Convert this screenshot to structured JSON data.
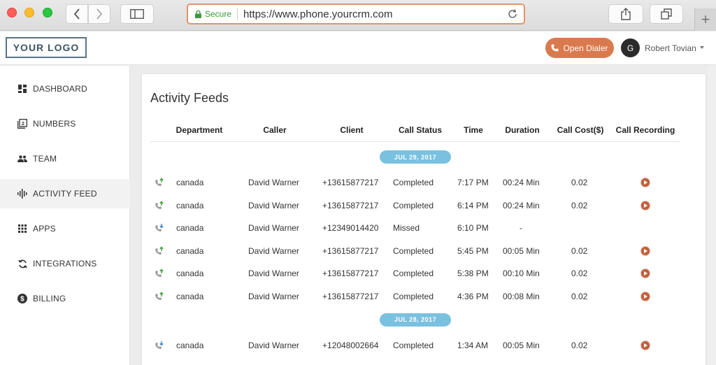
{
  "browser": {
    "secure_label": "Secure",
    "url": "https://www.phone.yourcrm.com",
    "new_tab_symbol": "+"
  },
  "header": {
    "logo_text": "YOUR LOGO",
    "dialer_label": "Open Dialer",
    "avatar_initial": "G",
    "user_name": "Robert Tovian"
  },
  "sidebar": {
    "items": [
      {
        "label": "DASHBOARD",
        "icon": "dashboard-icon"
      },
      {
        "label": "NUMBERS",
        "icon": "numbers-icon"
      },
      {
        "label": "TEAM",
        "icon": "team-icon"
      },
      {
        "label": "ACTIVITY FEED",
        "icon": "activity-icon"
      },
      {
        "label": "APPS",
        "icon": "apps-icon"
      },
      {
        "label": "INTEGRATIONS",
        "icon": "integrations-icon"
      },
      {
        "label": "BILLING",
        "icon": "billing-icon"
      }
    ],
    "active_index": 3
  },
  "main": {
    "title": "Activity Feeds",
    "columns": [
      "Department",
      "Caller",
      "Client",
      "Call Status",
      "Time",
      "Duration",
      "Call Cost($)",
      "Call Recording"
    ],
    "groups": [
      {
        "date": "JUL 29, 2017",
        "rows": [
          {
            "direction": "outgoing",
            "department": "canada",
            "caller": "David Warner",
            "client": "+13615877217",
            "status": "Completed",
            "time": "7:17 PM",
            "duration": "00:24 Min",
            "cost": "0.02",
            "recording": true
          },
          {
            "direction": "outgoing",
            "department": "canada",
            "caller": "David Warner",
            "client": "+13615877217",
            "status": "Completed",
            "time": "6:14 PM",
            "duration": "00:24 Min",
            "cost": "0.02",
            "recording": true
          },
          {
            "direction": "incoming",
            "department": "canada",
            "caller": "David Warner",
            "client": "+12349014420",
            "status": "Missed",
            "time": "6:10 PM",
            "duration": "-",
            "cost": "",
            "recording": false
          },
          {
            "direction": "outgoing",
            "department": "canada",
            "caller": "David Warner",
            "client": "+13615877217",
            "status": "Completed",
            "time": "5:45 PM",
            "duration": "00:05 Min",
            "cost": "0.02",
            "recording": true
          },
          {
            "direction": "outgoing",
            "department": "canada",
            "caller": "David Warner",
            "client": "+13615877217",
            "status": "Completed",
            "time": "5:38 PM",
            "duration": "00:10 Min",
            "cost": "0.02",
            "recording": true
          },
          {
            "direction": "outgoing",
            "department": "canada",
            "caller": "David Warner",
            "client": "+13615877217",
            "status": "Completed",
            "time": "4:36 PM",
            "duration": "00:08 Min",
            "cost": "0.02",
            "recording": true
          }
        ]
      },
      {
        "date": "JUL 28, 2017",
        "rows": [
          {
            "direction": "incoming",
            "department": "canada",
            "caller": "David Warner",
            "client": "+12048002664",
            "status": "Completed",
            "time": "1:34 AM",
            "duration": "00:05 Min",
            "cost": "0.02",
            "recording": true
          }
        ]
      }
    ]
  },
  "colors": {
    "accent": "#d97a4e",
    "date_pill": "#7ac1e0",
    "play": "#c0603d",
    "outgoing_arrow": "#3a9a3a",
    "incoming_arrow": "#3b82c4"
  }
}
